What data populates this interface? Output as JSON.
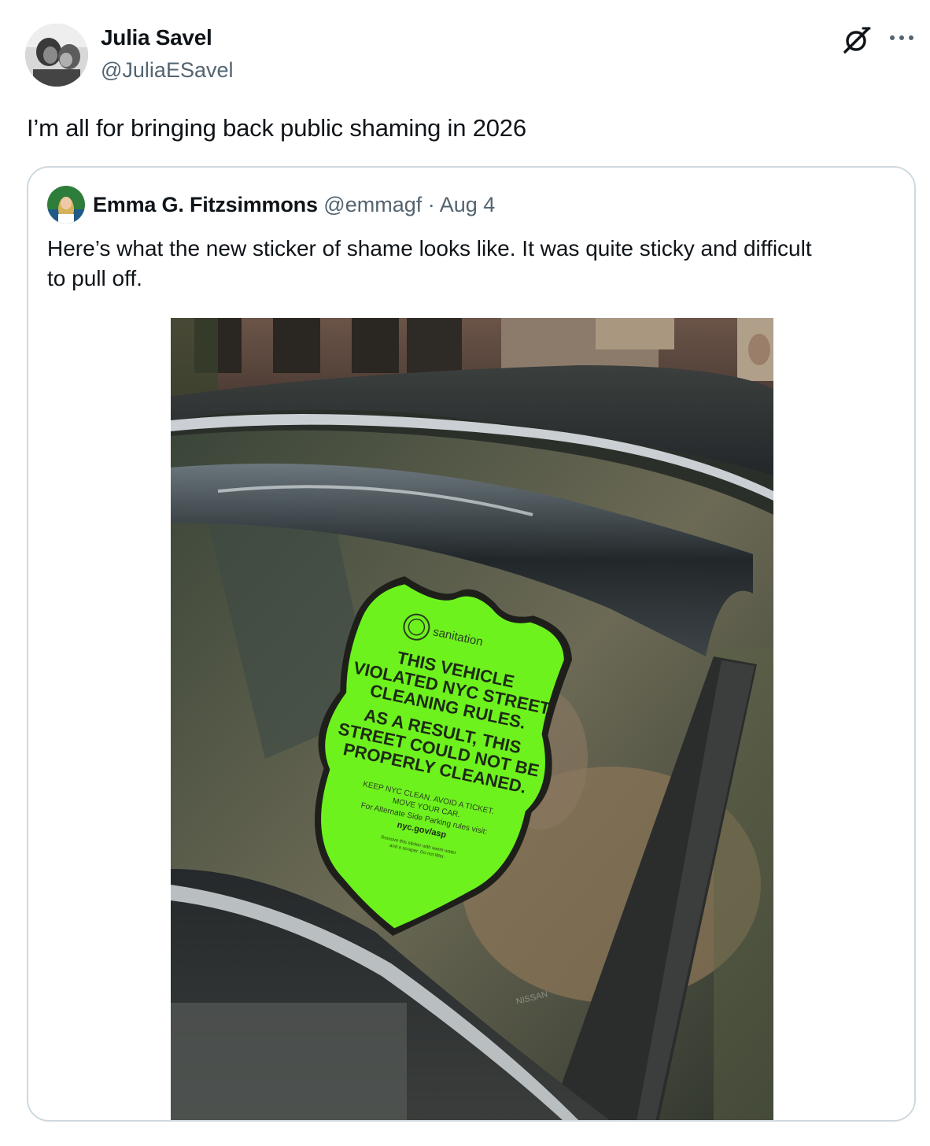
{
  "author": {
    "display_name": "Julia Savel",
    "handle": "@JuliaESavel"
  },
  "tweet": {
    "text": "I’m all for bringing back public shaming in  2026"
  },
  "icons": {
    "grok": "grok-icon",
    "more": "more-icon"
  },
  "quoted": {
    "display_name": "Emma G. Fitzsimmons",
    "handle": "@emmagf",
    "separator": " · ",
    "date": "Aug 4",
    "text": "Here’s what the new sticker of shame looks like. It was quite sticky and difficult to pull off.",
    "photo": {
      "sticker": {
        "brand": "sanitation",
        "line1": "THIS VEHICLE",
        "line2": "VIOLATED NYC STREET",
        "line3": "CLEANING RULES.",
        "line4": "AS A RESULT, THIS",
        "line5": "STREET COULD NOT BE",
        "line6": "PROPERLY CLEANED.",
        "small1": "KEEP NYC CLEAN. AVOID A TICKET.",
        "small2": "MOVE YOUR CAR.",
        "small3": "For Alternate Side Parking rules visit:",
        "url": "nyc.gov/asp",
        "fine1": "Remove this sticker with warm water",
        "fine2": "and a scraper. Do not litter."
      },
      "window_mark": "NISSAN",
      "sticker_color": "#6ef21e"
    }
  },
  "colors": {
    "text_primary": "#0f1419",
    "text_secondary": "#536471",
    "border": "#cfd9de"
  }
}
